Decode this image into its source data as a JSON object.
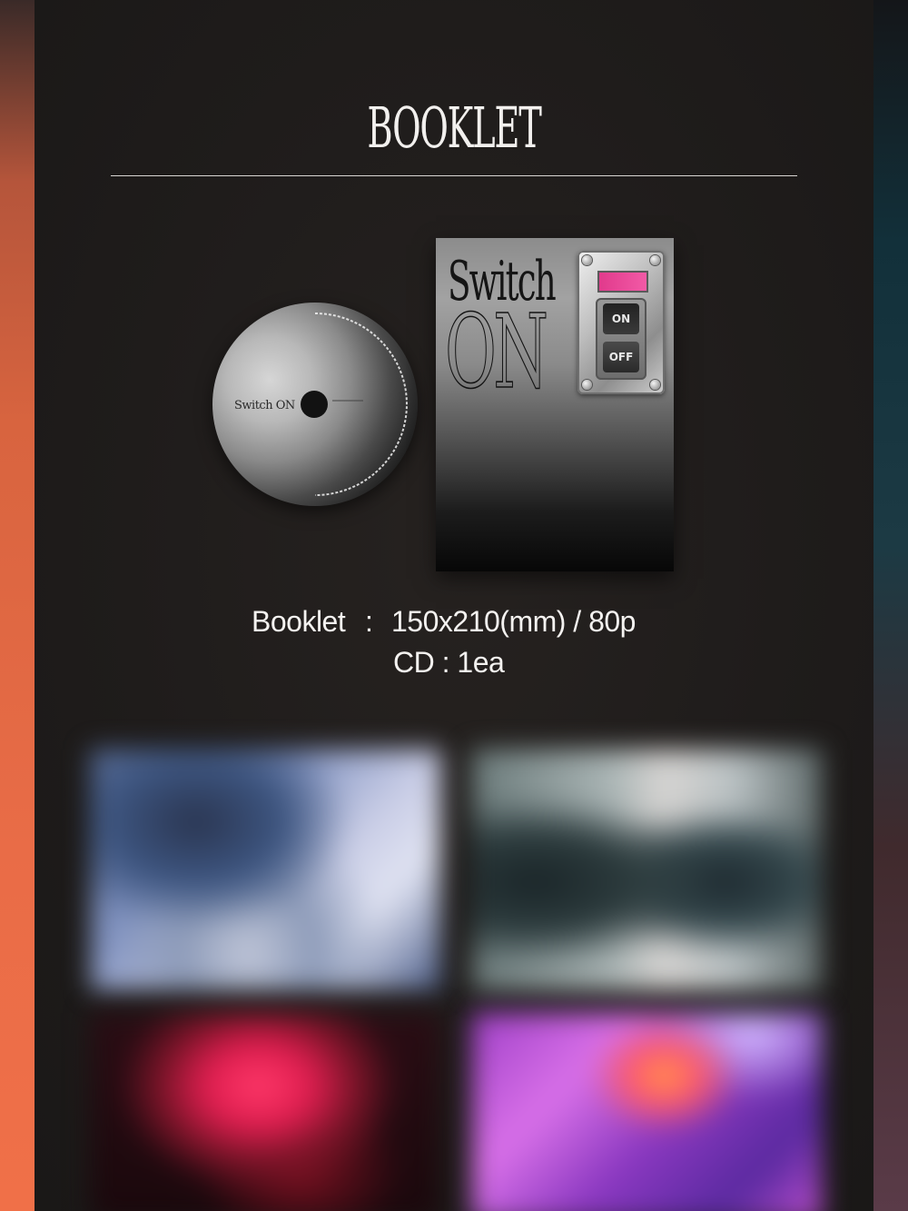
{
  "section": {
    "title": "BOOKLET"
  },
  "cd": {
    "disc_text": "Switch ON"
  },
  "booklet_cover": {
    "title_line1": "Switch",
    "title_line2": "ON",
    "switch_on_label": "ON",
    "switch_off_label": "OFF",
    "indicator_color": "#e8418f"
  },
  "specs": {
    "booklet_label": "Booklet",
    "booklet_separator": ":",
    "booklet_value": "150x210(mm) / 80p",
    "cd_line": "CD : 1ea"
  },
  "colors": {
    "background": "#1e1b1a",
    "left_accent": "#e86a45",
    "text": "#f4f2f0"
  }
}
